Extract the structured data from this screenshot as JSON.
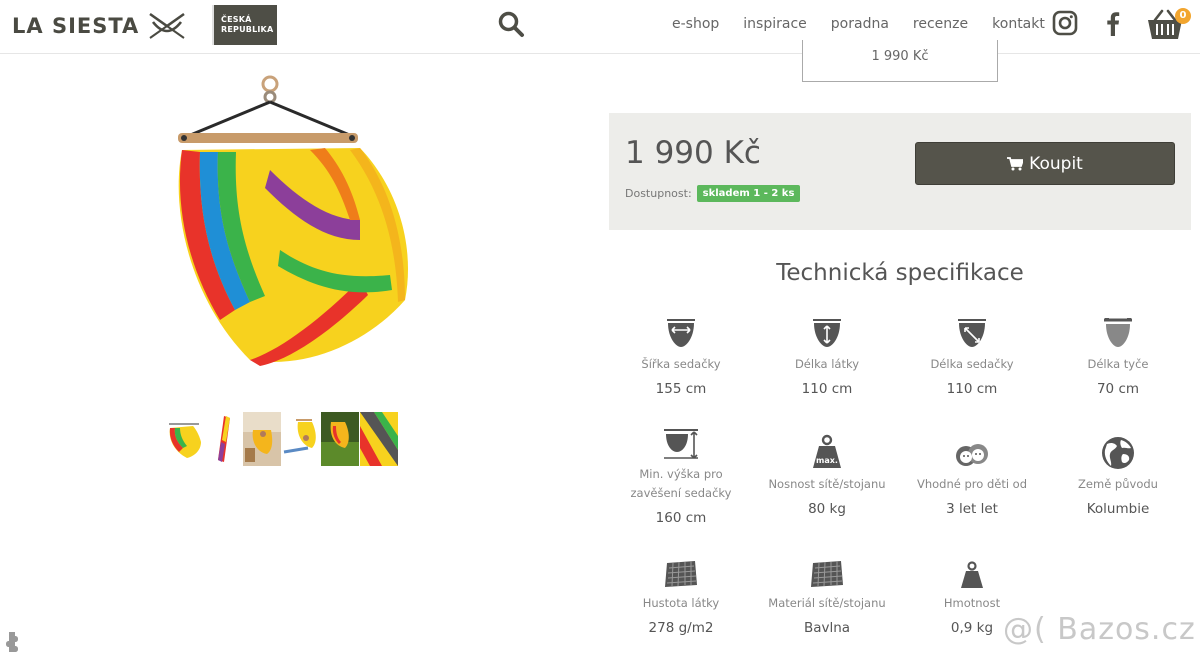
{
  "brand": {
    "logo_text": "LA SIESTA",
    "country_line1": "ČESKÁ",
    "country_line2": "REPUBLIKA"
  },
  "nav": {
    "items": [
      {
        "label": "e-shop"
      },
      {
        "label": "inspirace"
      },
      {
        "label": "poradna"
      },
      {
        "label": "recenze"
      },
      {
        "label": "kontakt"
      }
    ]
  },
  "cart": {
    "count": "0"
  },
  "variant": {
    "price_label": "1 990 Kč"
  },
  "product": {
    "price": "1 990 Kč",
    "availability_label": "Dostupnost:",
    "stock_badge": "skladem 1 - 2 ks",
    "buy_label": "Koupit"
  },
  "specs": {
    "title": "Technická specifikace",
    "items": [
      {
        "icon": "seat-width-icon",
        "label": "Šířka sedačky",
        "value": "155 cm"
      },
      {
        "icon": "fabric-length-icon",
        "label": "Délka látky",
        "value": "110 cm"
      },
      {
        "icon": "seat-length-icon",
        "label": "Délka sedačky",
        "value": "110 cm"
      },
      {
        "icon": "bar-length-icon",
        "label": "Délka tyče",
        "value": "70 cm"
      },
      {
        "icon": "hanging-height-icon",
        "label_line1": "Min. výška pro",
        "label_line2": "zavěšení sedačky",
        "value": "160 cm"
      },
      {
        "icon": "max-load-icon",
        "label": "Nosnost sítě/stojanu",
        "value": "80 kg"
      },
      {
        "icon": "kids-icon",
        "label": "Vhodné pro děti od",
        "value": "3 let let"
      },
      {
        "icon": "globe-icon",
        "label": "Země původu",
        "value": "Kolumbie"
      },
      {
        "icon": "fabric-density-icon",
        "label": "Hustota látky",
        "value": "278 g/m2"
      },
      {
        "icon": "material-icon",
        "label": "Materiál sítě/stojanu",
        "value": "Bavlna"
      },
      {
        "icon": "weight-icon",
        "label": "Hmotnost",
        "value": "0,9 kg"
      }
    ],
    "max_badge": "max."
  },
  "watermark": "@( Bazos.cz",
  "colors": {
    "panel_bg": "#ededea",
    "buy_button": "#55544b",
    "stock_green": "#5cb85c",
    "cart_badge": "#f2a52e"
  }
}
